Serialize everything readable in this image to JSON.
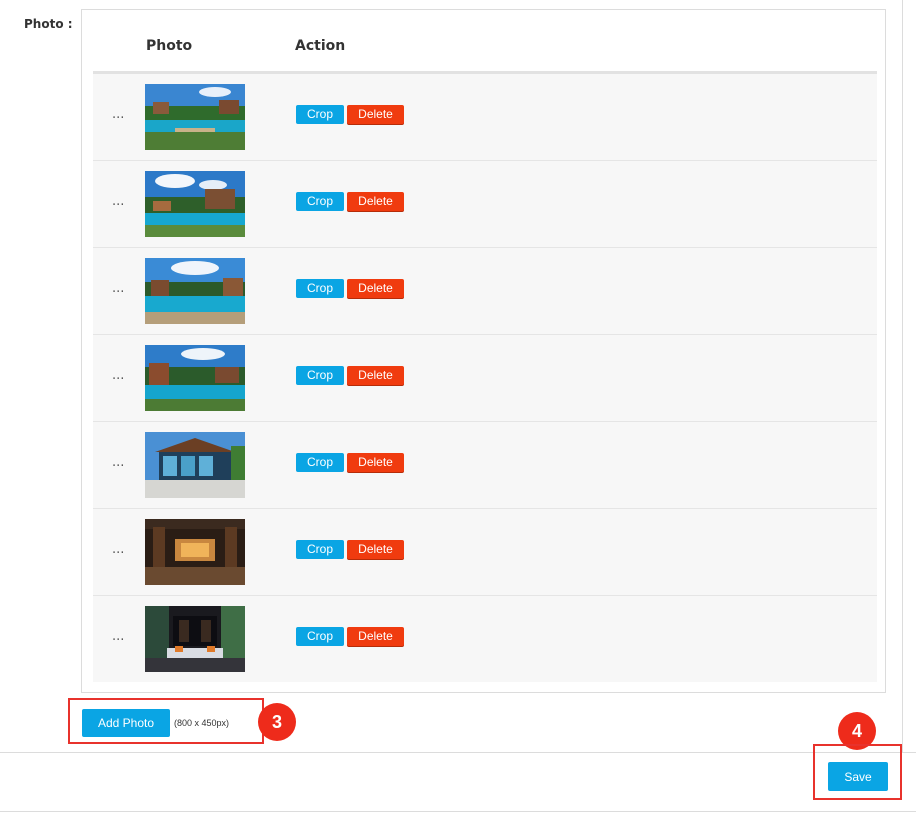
{
  "form": {
    "photo_label": "Photo :"
  },
  "table": {
    "headers": {
      "photo": "Photo",
      "action": "Action"
    },
    "handle_text": "...",
    "crop_label": "Crop",
    "delete_label": "Delete",
    "rows": [
      {
        "thumbnail": "resort-pool-aerial-photo"
      },
      {
        "thumbnail": "resort-pool-sunloungers-photo"
      },
      {
        "thumbnail": "resort-pool-wide-photo"
      },
      {
        "thumbnail": "resort-pool-villas-photo"
      },
      {
        "thumbnail": "glass-lobby-building-photo"
      },
      {
        "thumbnail": "lobby-interior-photo"
      },
      {
        "thumbnail": "lounge-interior-photo"
      }
    ]
  },
  "upload": {
    "add_label": "Add Photo",
    "size_hint": "(800 x 450px)"
  },
  "footer": {
    "save_label": "Save"
  },
  "annotations": {
    "step_3": "3",
    "step_4": "4"
  },
  "colors": {
    "primary": "#0aa5e4",
    "danger": "#f03b0f",
    "annotation": "#e8322c"
  }
}
